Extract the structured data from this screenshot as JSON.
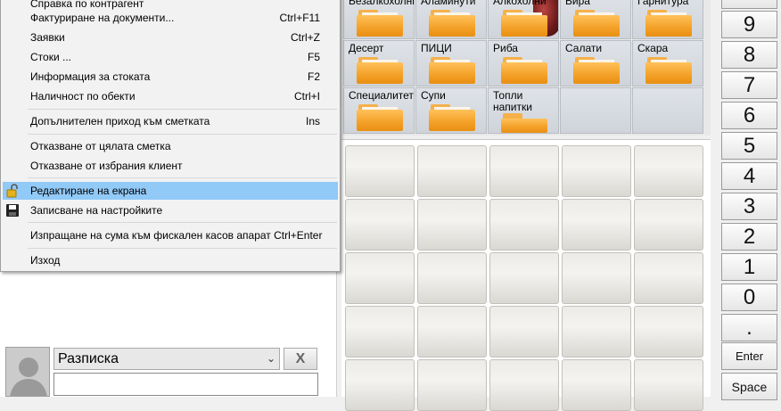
{
  "menu": {
    "items": [
      {
        "label": "Справка по контрагент",
        "shortcut": ""
      },
      {
        "label": "Фактуриране на документи...",
        "shortcut": "Ctrl+F11"
      },
      {
        "label": "Заявки",
        "shortcut": "Ctrl+Z"
      },
      {
        "label": "Стоки ...",
        "shortcut": "F5"
      },
      {
        "label": "Информация за стоката",
        "shortcut": "F2"
      },
      {
        "label": "Наличност по обекти",
        "shortcut": "Ctrl+I"
      },
      {
        "label": "Допълнителен приход към сметката",
        "shortcut": "Ins"
      },
      {
        "label": "Отказване от цялата сметка",
        "shortcut": ""
      },
      {
        "label": "Отказване от избрания клиент",
        "shortcut": ""
      },
      {
        "label": "Редактиране на екрана",
        "shortcut": "",
        "icon": "lock-icon",
        "highlighted": true
      },
      {
        "label": "Записване на настройките",
        "shortcut": "",
        "icon": "save-icon"
      },
      {
        "label": "Изпращане на сума към фискален касов апарат Ctrl+Enter",
        "shortcut": ""
      },
      {
        "label": "Изход",
        "shortcut": ""
      }
    ]
  },
  "customer": {
    "document_type": "Разписка",
    "clear_label": "X",
    "input_value": ""
  },
  "categories": [
    {
      "label": "Безалкохолни"
    },
    {
      "label": "Аламинути"
    },
    {
      "label": "Алкохолни"
    },
    {
      "label": "Бира"
    },
    {
      "label": "Гарнитура"
    },
    {
      "label": "Десерт"
    },
    {
      "label": "ПИЦИ"
    },
    {
      "label": "Риба"
    },
    {
      "label": "Салати"
    },
    {
      "label": "Скара"
    },
    {
      "label": "Специалитети"
    },
    {
      "label": "Супи"
    },
    {
      "label": "Топли напитки"
    }
  ],
  "numpad": {
    "keys": [
      "9",
      "8",
      "7",
      "6",
      "5",
      "4",
      "3",
      "2",
      "1",
      "0",
      ".",
      "Enter",
      "Space"
    ]
  },
  "colors": {
    "menu_highlight": "#91c9f7",
    "folder_orange": "#f3a027"
  }
}
